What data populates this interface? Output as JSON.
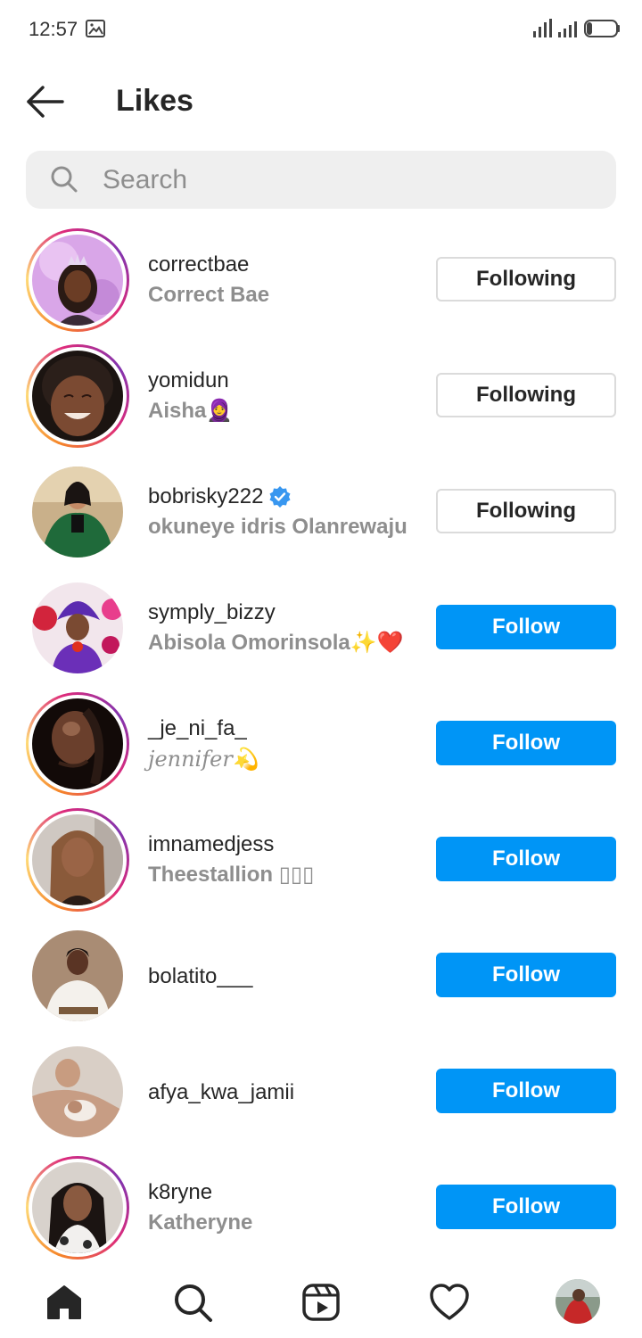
{
  "status_bar": {
    "time": "12:57"
  },
  "header": {
    "title": "Likes"
  },
  "search": {
    "placeholder": "Search"
  },
  "colors": {
    "follow_blue": "#0095f6",
    "secondary_text": "#8e8e8e",
    "verified_blue": "#3897f0"
  },
  "users": [
    {
      "username": "correctbae",
      "full_name": "Correct Bae",
      "button": "Following",
      "story_ring": true,
      "verified": false
    },
    {
      "username": "yomidun",
      "full_name": "Aisha🧕",
      "button": "Following",
      "story_ring": true,
      "verified": false
    },
    {
      "username": "bobrisky222",
      "full_name": "okuneye idris Olanrewaju",
      "button": "Following",
      "story_ring": false,
      "verified": true
    },
    {
      "username": "symply_bizzy",
      "full_name": "Abisola Omorinsola✨❤️",
      "button": "Follow",
      "story_ring": false,
      "verified": false
    },
    {
      "username": "_je_ni_fa_",
      "full_name": "jennifer💫",
      "button": "Follow",
      "story_ring": true,
      "verified": false
    },
    {
      "username": "imnamedjess",
      "full_name": "Theestallion ▯▯▯",
      "button": "Follow",
      "story_ring": true,
      "verified": false
    },
    {
      "username": "bolatito___",
      "full_name": "",
      "button": "Follow",
      "story_ring": false,
      "verified": false
    },
    {
      "username": "afya_kwa_jamii",
      "full_name": "",
      "button": "Follow",
      "story_ring": false,
      "verified": false
    },
    {
      "username": "k8ryne",
      "full_name": "Katheryne",
      "button": "Follow",
      "story_ring": true,
      "verified": false
    }
  ],
  "tabbar": {
    "icons": [
      "home-icon",
      "search-icon",
      "reels-icon",
      "heart-icon",
      "profile-avatar"
    ]
  }
}
